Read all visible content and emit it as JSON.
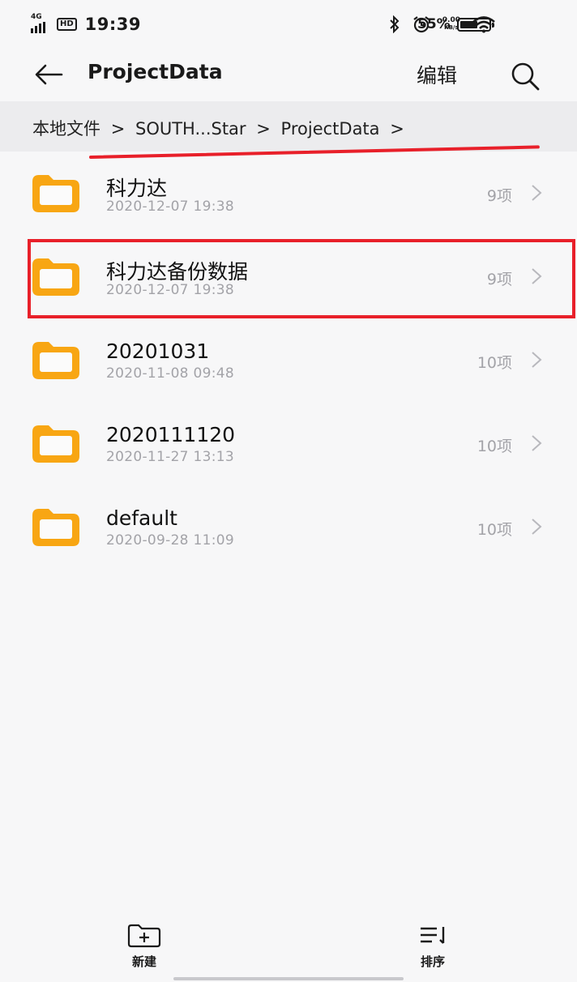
{
  "status_bar": {
    "network": "4G",
    "hd": "HD",
    "time": "19:39",
    "net_speed_value": "0.00",
    "net_speed_unit": "KB/s",
    "battery_percent": "55%",
    "icons": [
      "signal-icon",
      "hd-icon",
      "bluetooth-icon",
      "alarm-icon",
      "wifi-icon",
      "battery-icon"
    ]
  },
  "appbar": {
    "title": "ProjectData",
    "edit_label": "编辑",
    "back_icon": "arrow-left-icon",
    "search_icon": "search-icon"
  },
  "breadcrumb": {
    "items": [
      "本地文件",
      "SOUTH...Star",
      "ProjectData"
    ],
    "separator": ">"
  },
  "files": [
    {
      "name": "科力达",
      "date": "2020-12-07 19:38",
      "count": "9项"
    },
    {
      "name": "科力达备份数据",
      "date": "2020-12-07 19:38",
      "count": "9项"
    },
    {
      "name": "20201031",
      "date": "2020-11-08 09:48",
      "count": "10项"
    },
    {
      "name": "2020111120",
      "date": "2020-11-27 13:13",
      "count": "10项"
    },
    {
      "name": "default",
      "date": "2020-09-28 11:09",
      "count": "10项"
    }
  ],
  "bottom_bar": {
    "new_label": "新建",
    "sort_label": "排序"
  },
  "colors": {
    "folder": "#f8a613",
    "annotation": "#e8202a",
    "secondary_text": "#a3a3a8"
  }
}
